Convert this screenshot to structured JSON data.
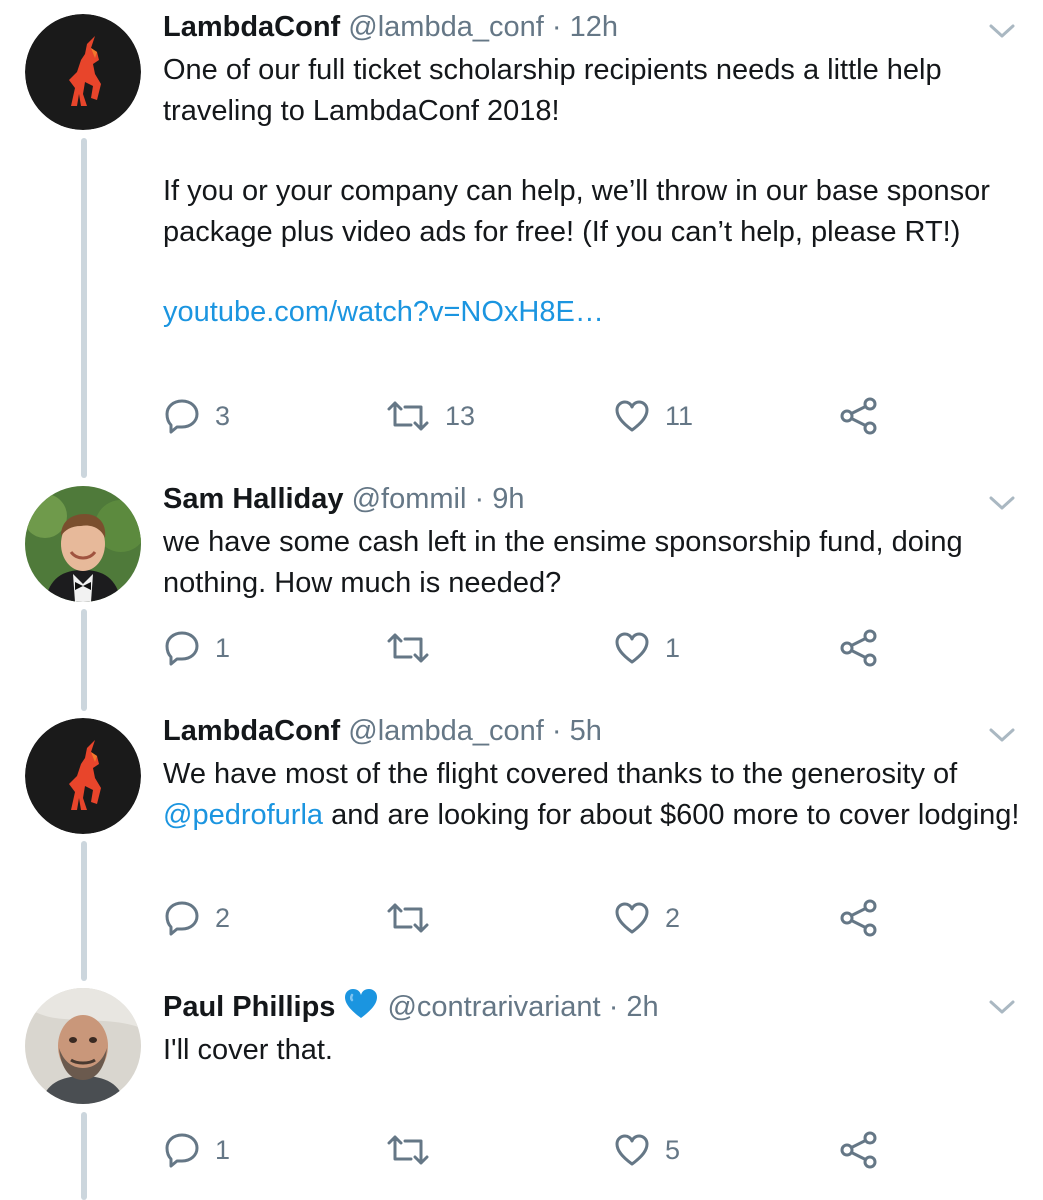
{
  "tweets": [
    {
      "name": "LambdaConf",
      "handle": "@lambda_conf",
      "dot": "·",
      "time": "12h",
      "avatar": "unicorn-logo",
      "verified": false,
      "paragraphs": [
        "One of our full ticket scholarship recipients needs a little help traveling to LambdaConf 2018!",
        "If you or your company can help, we’ll throw in our base sponsor package plus video ads for free! (If you can’t help, please RT!)"
      ],
      "link": "youtube.com/watch?v=NOxH8E…",
      "replies": "3",
      "retweets": "13",
      "likes": "11"
    },
    {
      "name": "Sam Halliday",
      "handle": "@fommil",
      "dot": "·",
      "time": "9h",
      "avatar": "person-photo",
      "verified": false,
      "text": "we have some cash left in the ensime sponsorship fund, doing nothing. How much is needed?",
      "replies": "1",
      "retweets": "",
      "likes": "1"
    },
    {
      "name": "LambdaConf",
      "handle": "@lambda_conf",
      "dot": "·",
      "time": "5h",
      "avatar": "unicorn-logo",
      "verified": false,
      "mention": "@pedrofurla",
      "text_before": "We have most of the flight covered thanks to the generosity of",
      "text_after": " and are looking for about $600 more to cover lodging!",
      "replies": "2",
      "retweets": "",
      "likes": "2"
    },
    {
      "name": "Paul Phillips",
      "handle": "@contrarivariant",
      "dot": "·",
      "time": "2h",
      "avatar": "person-photo",
      "verified": true,
      "verified_icon": "blue-heart-icon",
      "text": "I'll cover that.",
      "replies": "1",
      "retweets": "",
      "likes": "5"
    }
  ],
  "colors": {
    "link": "#1b95e0",
    "muted": "#657786",
    "thread_line": "#ccd6dd"
  }
}
